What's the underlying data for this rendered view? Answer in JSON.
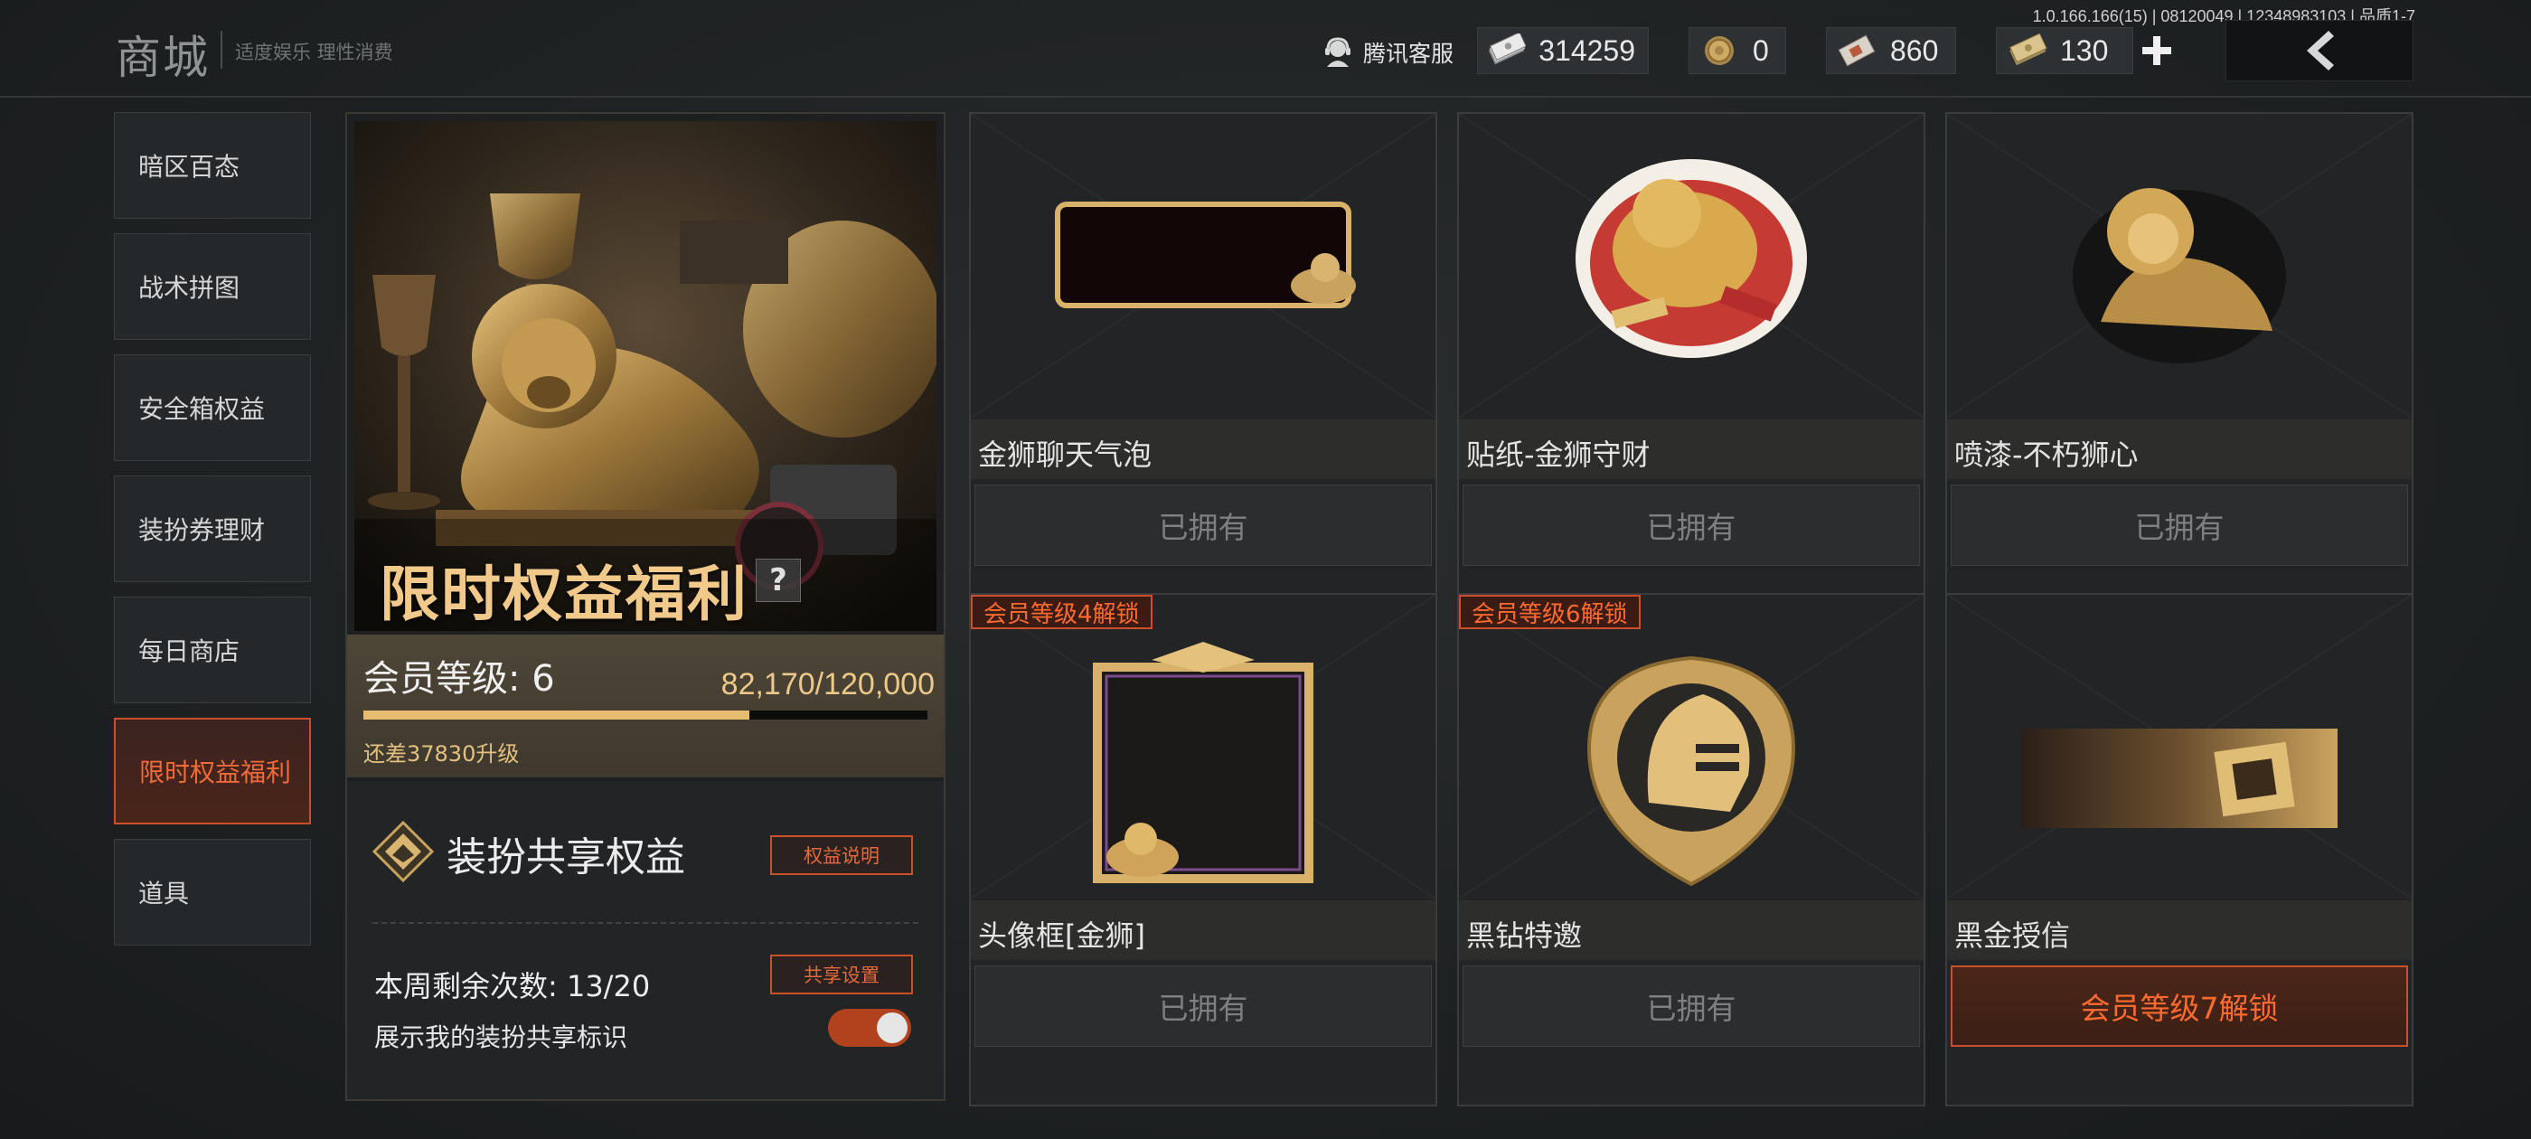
{
  "version": "1.0.166.166(15) | 08120049 | 12348983103 | 品质1-7",
  "header": {
    "title": "商城",
    "slogan": "适度娱乐 理性消费",
    "service_label": "腾讯客服",
    "currencies": [
      {
        "icon": "cash-bundle-icon",
        "value": "314259"
      },
      {
        "icon": "gold-coin-icon",
        "value": "0"
      },
      {
        "icon": "voucher-icon",
        "value": "860"
      },
      {
        "icon": "banknote-icon",
        "value": "130"
      }
    ],
    "add_icon": "plus-icon",
    "back_icon": "chevron-left-icon"
  },
  "sidebar": {
    "items": [
      {
        "label": "暗区百态",
        "active": false
      },
      {
        "label": "战术拼图",
        "active": false
      },
      {
        "label": "安全箱权益",
        "active": false
      },
      {
        "label": "装扮券理财",
        "active": false
      },
      {
        "label": "每日商店",
        "active": false
      },
      {
        "label": "限时权益福利",
        "active": true
      },
      {
        "label": "道具",
        "active": false
      }
    ]
  },
  "panel": {
    "hero_title": "限时权益福利",
    "help_label": "?",
    "level_label": "会员等级: 6",
    "level_progress_text": "82,170/120,000",
    "level_progress_value": 0.6848,
    "level_need": "还差37830升级",
    "share": {
      "title": "装扮共享权益",
      "info_button": "权益说明",
      "settings_button": "共享设置",
      "count_text": "本周剩余次数: 13/20",
      "show_label": "展示我的装扮共享标识",
      "toggle_on": true
    }
  },
  "cards": [
    {
      "name": "金狮聊天气泡",
      "action": "已拥有",
      "badge": "",
      "icon": "chat-bubble-lion-icon"
    },
    {
      "name": "贴纸-金狮守财",
      "action": "已拥有",
      "badge": "",
      "icon": "lion-sticker-icon"
    },
    {
      "name": "喷漆-不朽狮心",
      "action": "已拥有",
      "badge": "",
      "icon": "lion-spray-icon"
    },
    {
      "name": "头像框[金狮]",
      "action": "已拥有",
      "badge": "会员等级4解锁",
      "icon": "avatar-frame-icon"
    },
    {
      "name": "黑钻特邀",
      "action": "已拥有",
      "badge": "会员等级6解锁",
      "icon": "helmet-emblem-icon"
    },
    {
      "name": "黑金授信",
      "action": "会员等级7解锁",
      "badge": "",
      "icon": "gold-card-banner-icon"
    }
  ],
  "colors": {
    "accent_orange": "#c9502a",
    "gold_text": "#f1c98a",
    "unlock_text": "#ff6a2e"
  }
}
